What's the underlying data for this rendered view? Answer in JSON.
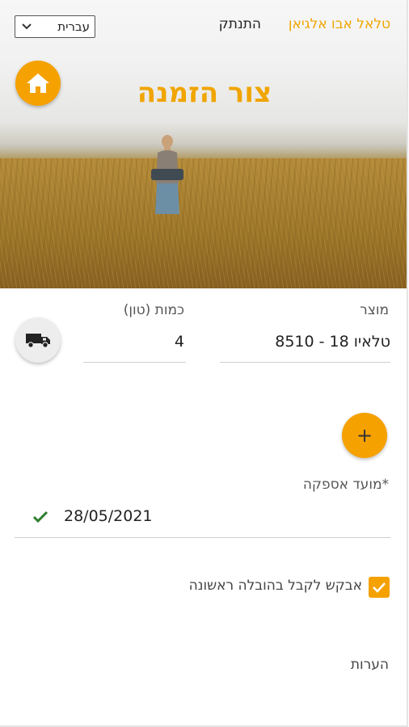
{
  "header": {
    "user_name": "טלאל אבו אלגיאן",
    "logout_label": "התנתק",
    "language": {
      "selected": "עברית",
      "icon": "chevron-down-icon"
    }
  },
  "hero": {
    "title": "צור הזמנה",
    "home_icon": "home-icon"
  },
  "order": {
    "product_label": "מוצר",
    "product_value": "8510 - 18 טלאיו",
    "quantity_label": "כמות (טון)",
    "quantity_value": "4",
    "truck_icon": "truck-icon",
    "add_label": "+"
  },
  "delivery": {
    "label": "*מועד אספקה",
    "date_value": "28/05/2021",
    "valid_icon": "checkmark-icon"
  },
  "first_delivery": {
    "label": "אבקש לקבל בהובלה ראשונה",
    "checked": true
  },
  "notes": {
    "label": "הערות"
  },
  "colors": {
    "accent": "#f5a100",
    "valid": "#2f7d2f"
  }
}
